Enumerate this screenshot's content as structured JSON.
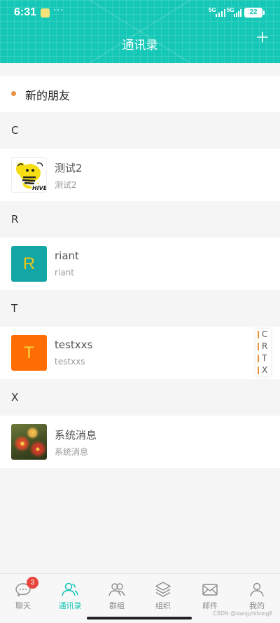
{
  "status": {
    "time": "6:31",
    "net1": "5G",
    "net2": "5G",
    "battery": "22"
  },
  "header": {
    "title": "通讯录",
    "add_icon": "plus-icon"
  },
  "new_friends": {
    "label": "新的朋友",
    "dot_color": "#e99444"
  },
  "sections": [
    {
      "letter": "C",
      "contact": {
        "name": "测试2",
        "sub": "测试2",
        "avatar": "hive-logo-image"
      }
    },
    {
      "letter": "R",
      "contact": {
        "name": "riant",
        "sub": "riant",
        "avatar_letter": "R",
        "avatar_bg": "#14a5a5",
        "avatar_fg": "#f0c419"
      }
    },
    {
      "letter": "T",
      "contact": {
        "name": "testxxs",
        "sub": "testxxs",
        "avatar_letter": "T",
        "avatar_bg": "#ff6d05",
        "avatar_fg": "#f8d73a"
      }
    },
    {
      "letter": "X",
      "contact": {
        "name": "系统消息",
        "sub": "系统消息",
        "avatar": "flower-photo-image"
      }
    }
  ],
  "index_bar": [
    "C",
    "R",
    "T",
    "X"
  ],
  "tabs": [
    {
      "label": "聊天",
      "icon": "chat-icon",
      "badge": "3",
      "active": false
    },
    {
      "label": "通讯录",
      "icon": "contacts-icon",
      "active": true
    },
    {
      "label": "群组",
      "icon": "group-icon",
      "active": false
    },
    {
      "label": "组织",
      "icon": "layers-icon",
      "active": false
    },
    {
      "label": "邮件",
      "icon": "mail-icon",
      "active": false
    },
    {
      "label": "我的",
      "icon": "profile-icon",
      "active": false
    }
  ],
  "colors": {
    "accent": "#14c7b6",
    "badge": "#e8453c"
  },
  "watermark": "CSDN @xiangzhihong8"
}
